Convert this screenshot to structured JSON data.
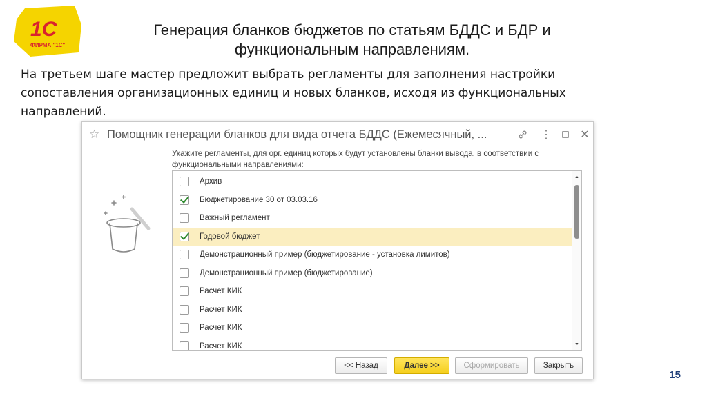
{
  "slide": {
    "title_line1": "Генерация бланков бюджетов по статьям БДДС и БДР и",
    "title_line2": "функциональным направлениям.",
    "description_line1": "На третьем шаге мастер предложит выбрать регламенты для заполнения настройки",
    "description_line2": "сопоставления организационных единиц и новых бланков, исходя из функциональных",
    "description_line3": "направлений.",
    "page_number": "15",
    "logo_text": "1С",
    "logo_subtext": "ФИРМА \"1С\"",
    "logo_color": "#f5d400",
    "logo_text_color": "#d9232e"
  },
  "dialog": {
    "title": "Помощник генерации бланков для вида отчета БДДС (Ежемесячный, ...",
    "instruction_line1": "Укажите регламенты, для орг. единиц которых будут установлены бланки вывода, в соответствии с",
    "instruction_line2": "функциональными направлениями:",
    "icons": {
      "favorite": "star-icon",
      "link": "link-icon",
      "more": "more-icon",
      "maximize": "maximize-icon",
      "close": "close-icon"
    },
    "items": [
      {
        "label": "Архив",
        "checked": false,
        "selected": false
      },
      {
        "label": "Бюджетирование 30 от 03.03.16",
        "checked": true,
        "selected": false
      },
      {
        "label": "Важный регламент",
        "checked": false,
        "selected": false
      },
      {
        "label": "Годовой бюджет",
        "checked": true,
        "selected": true
      },
      {
        "label": "Демонстрационный пример (бюджетирование - установка лимитов)",
        "checked": false,
        "selected": false
      },
      {
        "label": "Демонстрационный пример (бюджетирование)",
        "checked": false,
        "selected": false
      },
      {
        "label": "Расчет КИК",
        "checked": false,
        "selected": false
      },
      {
        "label": "Расчет КИК",
        "checked": false,
        "selected": false
      },
      {
        "label": "Расчет КИК",
        "checked": false,
        "selected": false
      },
      {
        "label": "Расчет КИК",
        "checked": false,
        "selected": false
      }
    ],
    "buttons": {
      "back": "<< Назад",
      "next": "Далее >>",
      "form": "Сформировать",
      "close": "Закрыть"
    },
    "colors": {
      "accent": "#f5cf1d",
      "selected_row": "#fbeec0",
      "check": "#2e8b2e"
    }
  }
}
